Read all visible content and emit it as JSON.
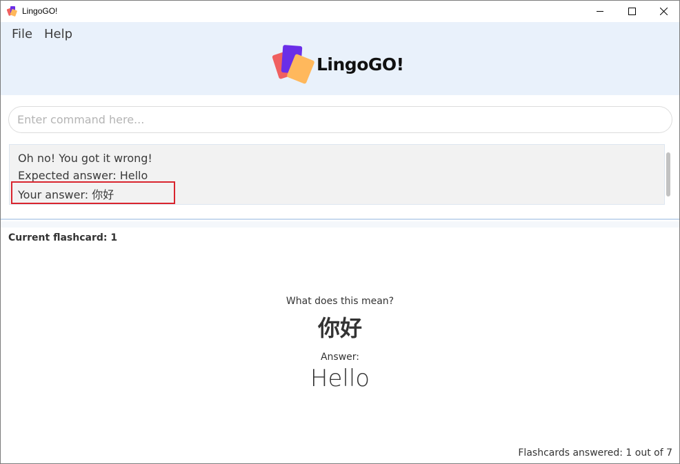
{
  "window": {
    "title": "LingoGO!"
  },
  "menu": {
    "file": "File",
    "help": "Help"
  },
  "logo": {
    "text": "LingoGO!"
  },
  "command": {
    "placeholder": "Enter command here...",
    "value": ""
  },
  "result": {
    "line1": "Oh no! You got it wrong!",
    "line2": "Expected answer: Hello",
    "line3": "Your answer: 你好"
  },
  "flashcard": {
    "current": "Current flashcard: 1",
    "question_label": "What does this mean?",
    "question": "你好",
    "answer_label": "Answer:",
    "answer": "Hello",
    "answered": "Flashcards answered: 1 out of 7"
  },
  "colors": {
    "header_bg": "#e9f1fb",
    "highlight": "#d9232d",
    "card_purple": "#6a2ee8",
    "card_red": "#f06060",
    "card_orange": "#ffb85c"
  }
}
